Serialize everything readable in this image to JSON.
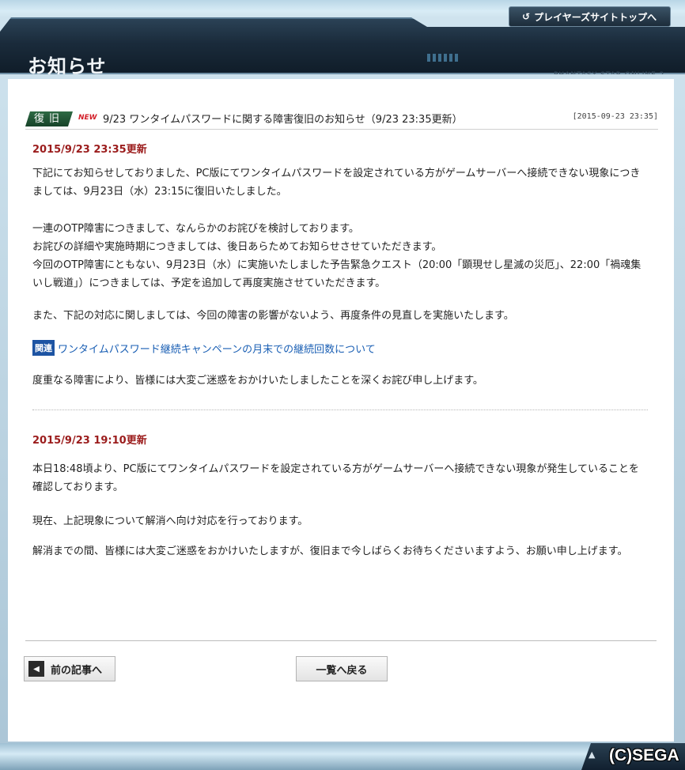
{
  "header": {
    "title": "お知らせ",
    "top_link": "プレイヤーズサイトトップへ",
    "ghost_text": "PHANTASY STAR ONLINE 2"
  },
  "article": {
    "badge": "復旧",
    "new_label": "NEW",
    "title": "9/23 ワンタイムパスワードに関する障害復旧のお知らせ（9/23 23:35更新）",
    "date": "[2015-09-23 23:35]"
  },
  "update1": {
    "heading": "2015/9/23 23:35更新",
    "para1": "下記にてお知らせしておりました、PC版にてワンタイムパスワードを設定されている方がゲームサーバーへ接続できない現象につきましては、9月23日（水）23:15に復旧いたしました。",
    "para2_line1": "一連のOTP障害につきまして、なんらかのお詫びを検討しております。",
    "para2_line2": "お詫びの詳細や実施時期につきましては、後日あらためてお知らせさせていただきます。",
    "para2_line3": "今回のOTP障害にともない、9月23日（水）に実施いたしました予告緊急クエスト（20:00「顕現せし星滅の災厄」、22:00「禍魂集いし戦道」）につきましては、予定を追加して再度実施させていただきます。",
    "para3": "また、下記の対応に関しましては、今回の障害の影響がないよう、再度条件の見直しを実施いたします。",
    "related_badge": "関連",
    "related_link": "ワンタイムパスワード継続キャンペーンの月末での継続回数について",
    "para4": "度重なる障害により、皆様には大変ご迷惑をおかけいたしましたことを深くお詫び申し上げます。"
  },
  "update2": {
    "heading": "2015/9/23 19:10更新",
    "para1": "本日18:48頃より、PC版にてワンタイムパスワードを設定されている方がゲームサーバーへ接続できない現象が発生していることを確認しております。",
    "para2": "現在、上記現象について解消へ向け対応を行っております。",
    "para3": "解消までの間、皆様には大変ご迷惑をおかけいたしますが、復旧まで今しばらくお待ちくださいますよう、お願い申し上げます。"
  },
  "nav": {
    "prev_label": "前の記事へ",
    "list_label": "一覧へ戻る"
  },
  "footer": {
    "copyright": "(C)SEGA"
  },
  "colors": {
    "header_bg": "#1a2b3b",
    "badge_green": "#174229",
    "update_heading": "#9b1c1c",
    "link_blue": "#1a5fb4",
    "related_badge_bg": "#1d54a3"
  }
}
